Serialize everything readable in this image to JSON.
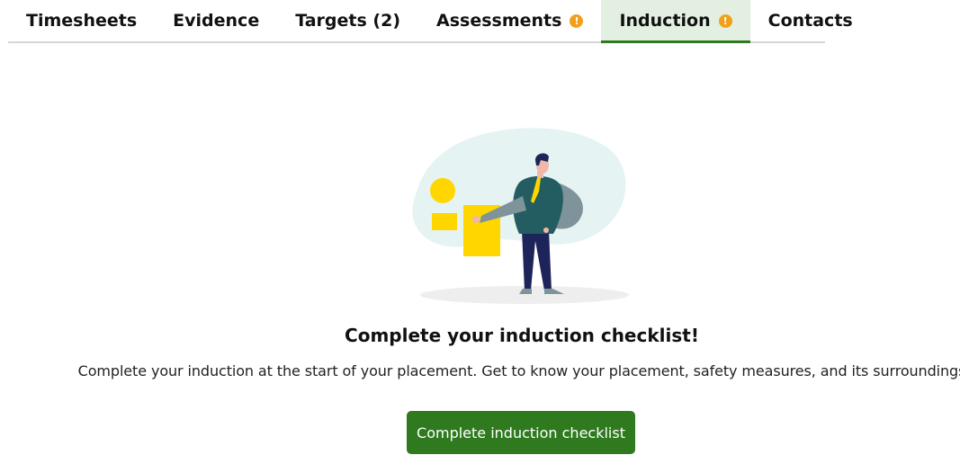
{
  "tabs": [
    {
      "label": "Timesheets",
      "warning": false
    },
    {
      "label": "Evidence",
      "warning": false
    },
    {
      "label": "Targets (2)",
      "warning": false
    },
    {
      "label": "Assessments",
      "warning": true
    },
    {
      "label": "Induction",
      "warning": true,
      "active": true
    },
    {
      "label": "Contacts",
      "warning": false
    }
  ],
  "warning_glyph": "!",
  "main": {
    "heading": "Complete your induction checklist!",
    "description": "Complete your induction at the start of your placement. Get to know your placement, safety measures, and its surroundings",
    "button_label": "Complete induction checklist"
  },
  "colors": {
    "accent": "#2f7a1f",
    "active_tab_bg": "#e3f0e1",
    "warning": "#f2a01c"
  },
  "icons": {
    "illustration": "person-presenting-illustration",
    "warning": "warning-circle-icon"
  }
}
